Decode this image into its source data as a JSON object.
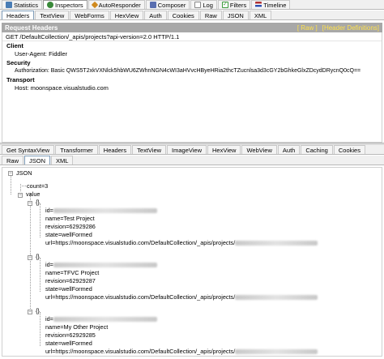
{
  "top_tabs": [
    {
      "label": "Statistics",
      "icon": "statistics-icon",
      "color": "#4a7db5"
    },
    {
      "label": "Inspectors",
      "icon": "inspectors-icon",
      "color": "#3a8a3a"
    },
    {
      "label": "AutoResponder",
      "icon": "autoresponder-icon",
      "color": "#d08a1e"
    },
    {
      "label": "Composer",
      "icon": "composer-icon",
      "color": "#5a6fb0"
    },
    {
      "label": "Log",
      "icon": "log-icon",
      "color": "#888888"
    },
    {
      "label": "Filters",
      "icon": "filters-icon",
      "color": "#3c9a3c"
    },
    {
      "label": "Timeline",
      "icon": "timeline-icon",
      "color": "#b03030"
    }
  ],
  "request_tabs": [
    "Headers",
    "TextView",
    "WebForms",
    "HexView",
    "Auth",
    "Cookies",
    "Raw",
    "JSON",
    "XML"
  ],
  "request_headers": {
    "title": "Request Headers",
    "raw_link": "[ Raw ]",
    "definitions_link": "[Header Definitions]",
    "request_line": "GET /DefaultCollection/_apis/projects?api-version=2.0 HTTP/1.1",
    "sections": {
      "client": "Client",
      "user_agent": "User-Agent: Fiddler",
      "security": "Security",
      "authorization": "Authorization: Basic QWS5T2xkVXNlck5hbWU6ZWhnNGN4cWI3aHVvcHByeHRia2thcTZucnlsa3d3cGY2bGhkeGlxZDcydDRycnQ0cQ==",
      "transport": "Transport",
      "host": "Host: moonspace.visualstudio.com"
    }
  },
  "response_tabs_row1": [
    "Get SyntaxView",
    "Transformer",
    "Headers",
    "TextView",
    "ImageView",
    "HexView",
    "WebView",
    "Auth",
    "Caching",
    "Cookies"
  ],
  "response_tabs_row2": [
    "Raw",
    "JSON",
    "XML"
  ],
  "tree": {
    "root": "JSON",
    "count": "count=3",
    "value": "value",
    "brace": "{}",
    "id_prefix": "id=",
    "url_prefix": "url=https://moonspace.visualstudio.com/DefaultCollection/_apis/projects/",
    "items": [
      {
        "name": "name=Test Project",
        "revision": "revision=62929286",
        "state": "state=wellFormed"
      },
      {
        "name": "name=TFVC Project",
        "revision": "revision=62929287",
        "state": "state=wellFormed"
      },
      {
        "name": "name=My Other Project",
        "revision": "revision=62929285",
        "state": "state=wellFormed"
      }
    ]
  }
}
